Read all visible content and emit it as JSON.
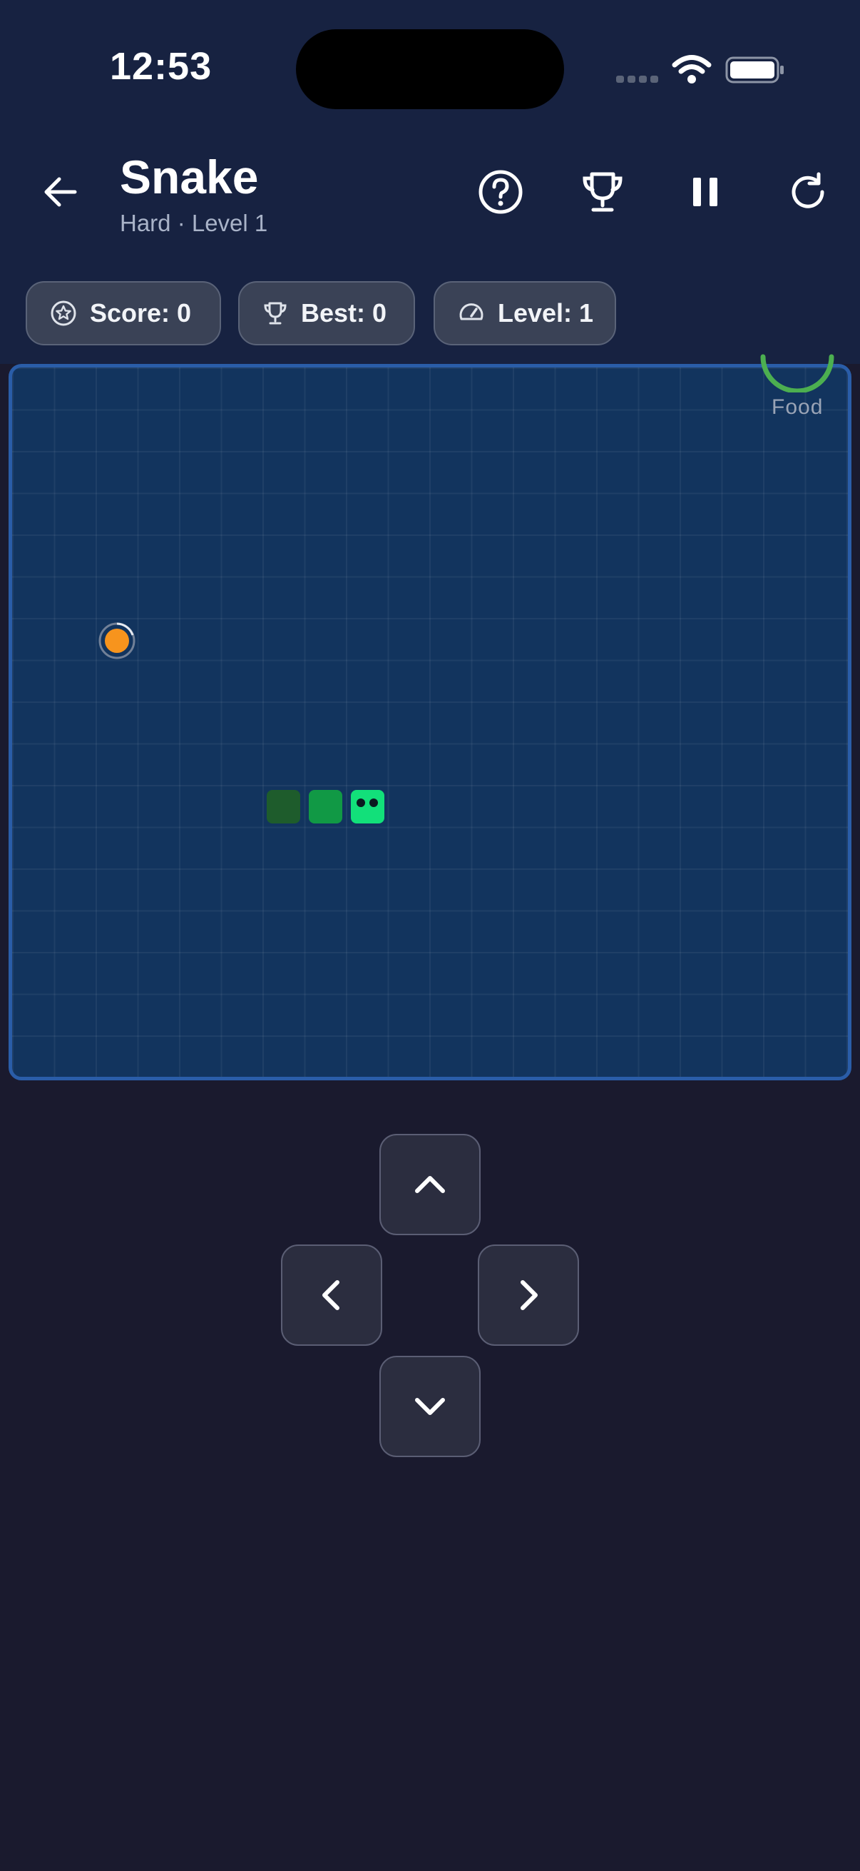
{
  "status_bar": {
    "time": "12:53"
  },
  "header": {
    "title": "Snake",
    "subtitle": "Hard · Level 1",
    "icons": {
      "back": "arrow-left-icon",
      "help": "help-circle-icon",
      "trophy": "trophy-icon",
      "pause": "pause-icon",
      "restart": "restart-icon"
    }
  },
  "stats": {
    "score": "Score: 0",
    "best": "Best: 0",
    "level": "Level: 1",
    "icons": {
      "score": "star-circle-icon",
      "best": "trophy-icon",
      "level": "speedometer-icon"
    }
  },
  "board": {
    "food_label": "Food",
    "snake_length": 3,
    "direction": "right"
  },
  "controls": {
    "up": "chevron-up-icon",
    "left": "chevron-left-icon",
    "right": "chevron-right-icon",
    "down": "chevron-down-icon"
  },
  "colors": {
    "header_bg": "#172241",
    "page_bg": "#1a1a2e",
    "board_bg": "#12345e",
    "board_border": "#2a5da8",
    "snake_head": "#12e07a",
    "snake_body": "#119945",
    "snake_tail": "#1e5c2c",
    "food": "#f7941d",
    "food_ring": "#4caf50"
  }
}
